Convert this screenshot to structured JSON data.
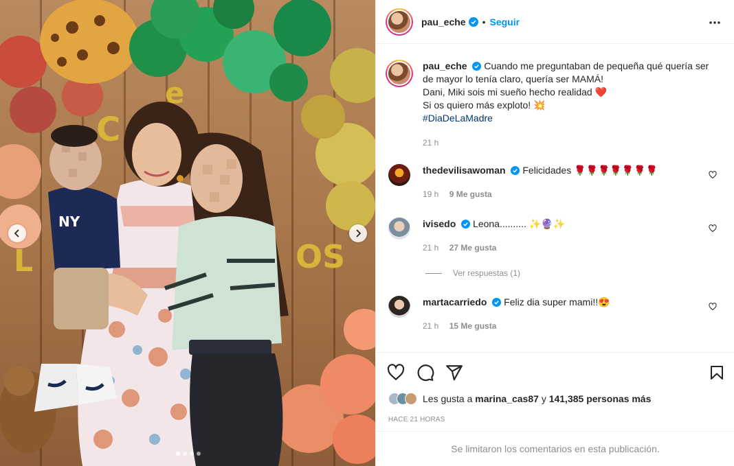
{
  "post": {
    "username": "pau_eche",
    "follow_label": "Seguir",
    "caption_lines": [
      "Cuando me preguntaban de pequeña qué quería ser de mayor lo tenía claro, quería ser MAMÁ!",
      "Dani, Miki sois mi sueño hecho realidad ❤️",
      "Si os quiero más exploto! 💥"
    ],
    "hashtag": "#DiaDeLaMadre",
    "caption_time": "21 h"
  },
  "comments": [
    {
      "username": "thedevilisawoman",
      "text": "Felicidades 🌹🌹🌹🌹🌹🌹🌹",
      "time": "19 h",
      "likes": "9 Me gusta"
    },
    {
      "username": "ivisedo",
      "text": "Leona.......... ✨🔮✨",
      "time": "21 h",
      "likes": "27 Me gusta"
    },
    {
      "username": "martacarriedo",
      "text": "Feliz dia super mami!!😍",
      "time": "21 h",
      "likes": "15 Me gusta"
    }
  ],
  "view_replies": "Ver respuestas (1)",
  "likes": {
    "prefix": "Les gusta a",
    "user": "marina_cas87",
    "joiner": "y",
    "count": "141,385 personas más"
  },
  "timestamp": "HACE 21 HORAS",
  "comments_limited": "Se limitaron los comentarios en esta publicación.",
  "icons": {
    "verified": "verified-badge-icon",
    "more": "more-options-icon",
    "like": "heart-icon",
    "comment": "comment-icon",
    "share": "share-icon",
    "save": "bookmark-icon"
  },
  "colors": {
    "link": "#0095f6",
    "hashtag": "#00376b",
    "muted": "#8e8e8e",
    "verified": "#0095f6"
  },
  "carousel": {
    "total_slides": 4,
    "current_slide": 1
  }
}
